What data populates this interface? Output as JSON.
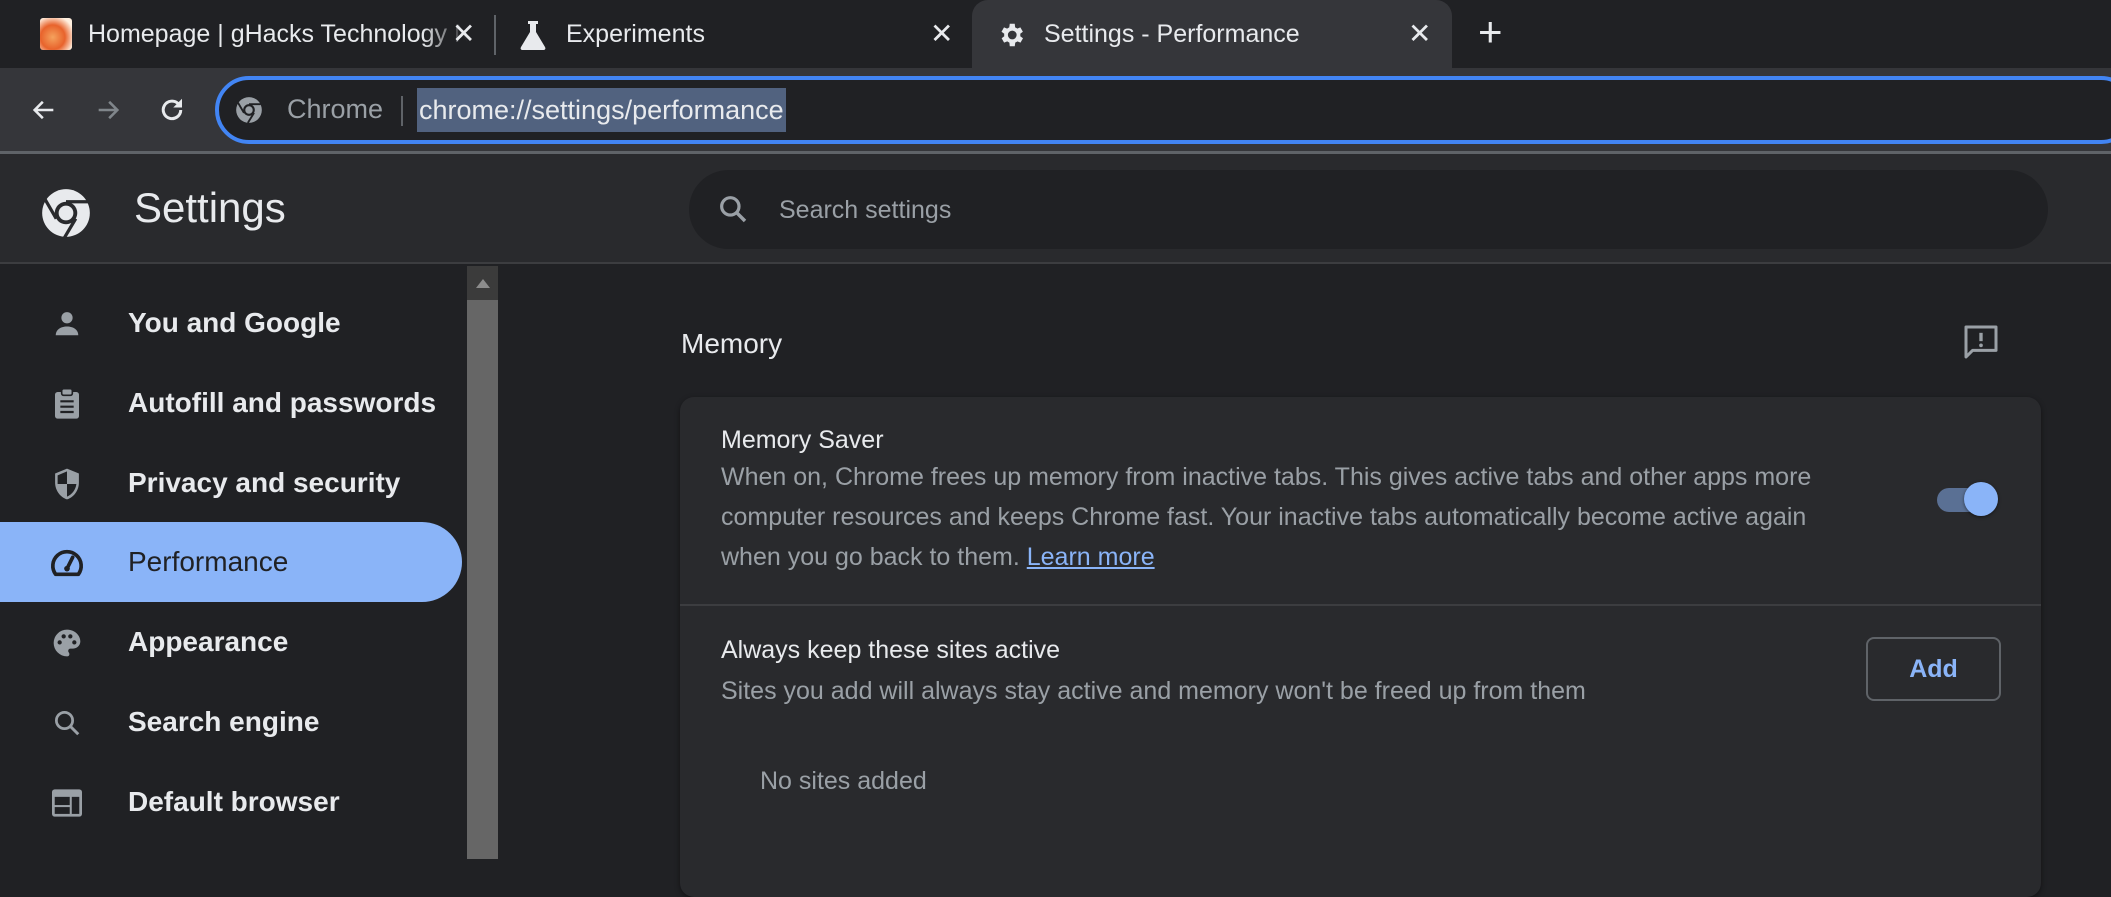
{
  "tabs": [
    {
      "title": "Homepage | gHacks Technology News",
      "icon": "ghacks-favicon",
      "active": false
    },
    {
      "title": "Experiments",
      "icon": "flask-icon",
      "active": false
    },
    {
      "title": "Settings - Performance",
      "icon": "gear-icon",
      "active": true
    }
  ],
  "tab_close_glyph": "✕",
  "new_tab_glyph": "+",
  "omnibox": {
    "origin_label": "Chrome",
    "url": "chrome://settings/performance"
  },
  "header": {
    "title": "Settings",
    "search_placeholder": "Search settings"
  },
  "sidebar": {
    "items": [
      {
        "label": "You and Google",
        "icon": "person-icon"
      },
      {
        "label": "Autofill and passwords",
        "icon": "clipboard-icon"
      },
      {
        "label": "Privacy and security",
        "icon": "shield-icon"
      },
      {
        "label": "Performance",
        "icon": "speedometer-icon",
        "selected": true
      },
      {
        "label": "Appearance",
        "icon": "palette-icon"
      },
      {
        "label": "Search engine",
        "icon": "search-icon"
      },
      {
        "label": "Default browser",
        "icon": "browser-window-icon"
      }
    ]
  },
  "main": {
    "section_title": "Memory",
    "memory_saver": {
      "title": "Memory Saver",
      "description": "When on, Chrome frees up memory from inactive tabs. This gives active tabs and other apps more computer resources and keeps Chrome fast. Your inactive tabs automatically become active again when you go back to them.",
      "learn_more": "Learn more",
      "enabled": true
    },
    "always_active": {
      "title": "Always keep these sites active",
      "description": "Sites you add will always stay active and memory won't be freed up from them",
      "add_button": "Add",
      "empty_text": "No sites added"
    }
  },
  "colors": {
    "accent": "#8ab4f8",
    "focus_ring": "#4285f4",
    "background": "#202124",
    "card": "#292a2d"
  }
}
